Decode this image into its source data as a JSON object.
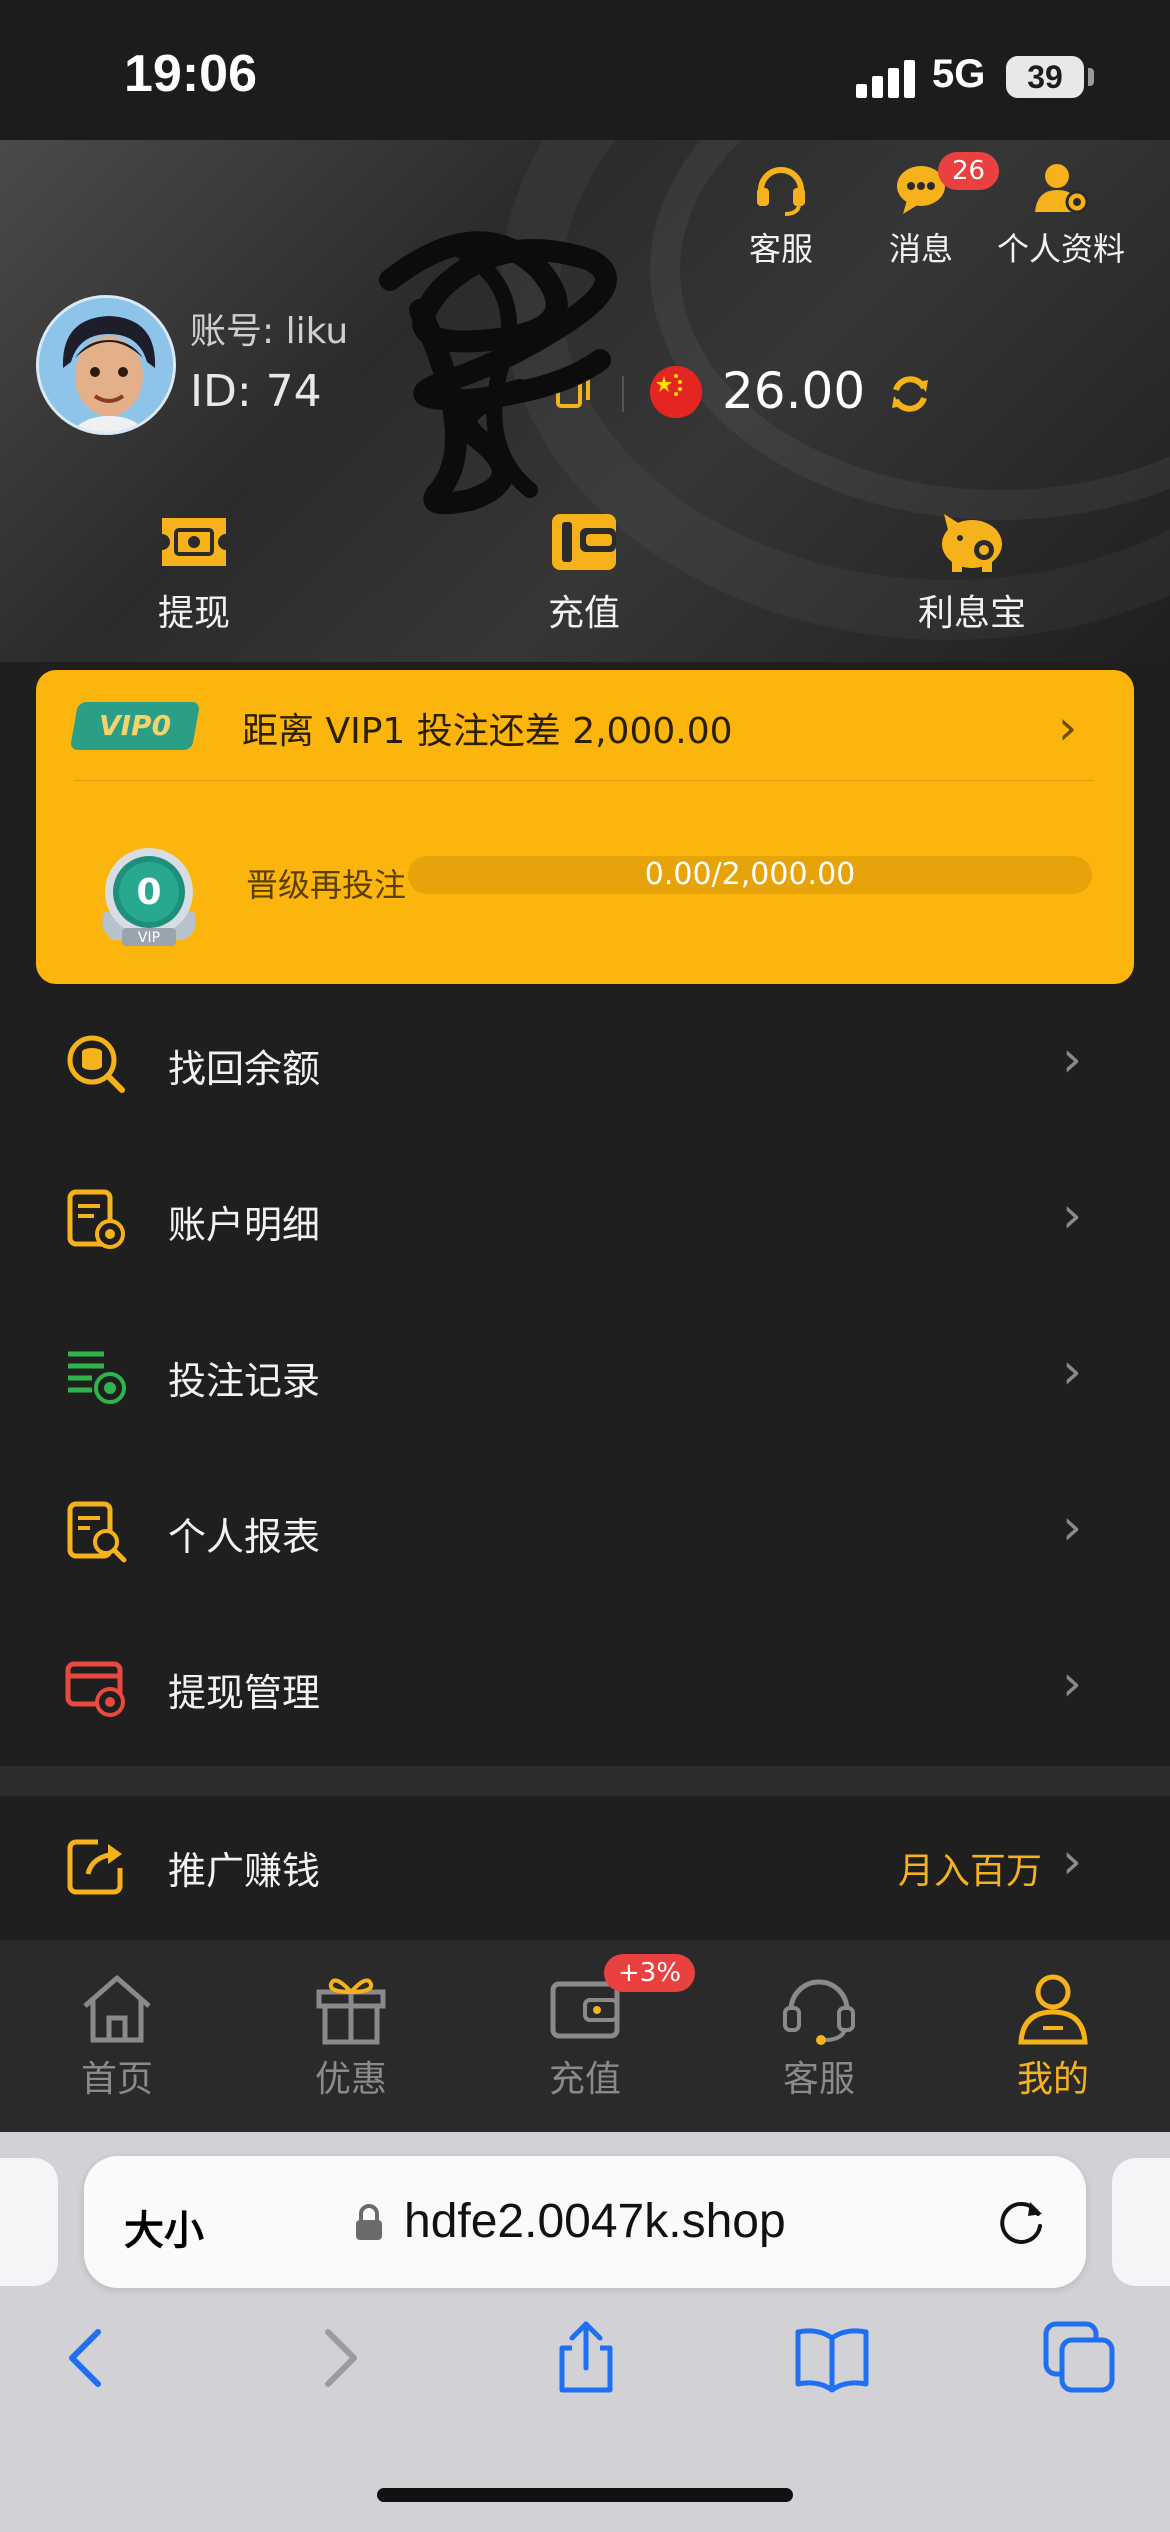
{
  "status_bar": {
    "time": "19:06",
    "network": "5G",
    "battery": "39"
  },
  "header": {
    "actions": [
      {
        "label": "客服",
        "icon": "headset-icon"
      },
      {
        "label": "消息",
        "icon": "chat-bubble-icon",
        "badge": "26"
      },
      {
        "label": "个人资料",
        "icon": "user-settings-icon"
      }
    ],
    "account_label": "账号: liku",
    "account_id": "ID: 74",
    "balance": "26.00",
    "quick_actions": [
      {
        "label": "提现",
        "icon": "cash-ticket-icon"
      },
      {
        "label": "充值",
        "icon": "wallet-icon"
      },
      {
        "label": "利息宝",
        "icon": "piggy-bank-icon"
      }
    ]
  },
  "vip": {
    "tag": "VIP0",
    "distance_text": "距离  VIP1  投注还差 2,000.00",
    "level": "0",
    "medal_label": "VIP",
    "upgrade_label": "晋级再投注",
    "progress_text": "0.00/2,000.00",
    "progress_fraction": 0
  },
  "menu": [
    {
      "label": "找回余额",
      "icon": "search-coins-icon"
    },
    {
      "label": "账户明细",
      "icon": "account-detail-icon"
    },
    {
      "label": "投注记录",
      "icon": "bet-record-icon"
    },
    {
      "label": "个人报表",
      "icon": "report-search-icon"
    },
    {
      "label": "提现管理",
      "icon": "withdraw-manage-icon"
    }
  ],
  "promo": {
    "label": "推广赚钱",
    "right_text": "月入百万",
    "icon": "share-icon"
  },
  "tabs": [
    {
      "label": "首页",
      "icon": "home-icon"
    },
    {
      "label": "优惠",
      "icon": "gift-icon"
    },
    {
      "label": "充值",
      "icon": "wallet-icon",
      "badge": "+3%"
    },
    {
      "label": "客服",
      "icon": "headset-icon"
    },
    {
      "label": "我的",
      "icon": "profile-icon",
      "active": true
    }
  ],
  "browser": {
    "size_button": "大小",
    "url": "hdfe2.0047k.shop"
  },
  "colors": {
    "accent": "#fbb50d",
    "badge": "#e94040",
    "background": "#1f1f1f"
  }
}
